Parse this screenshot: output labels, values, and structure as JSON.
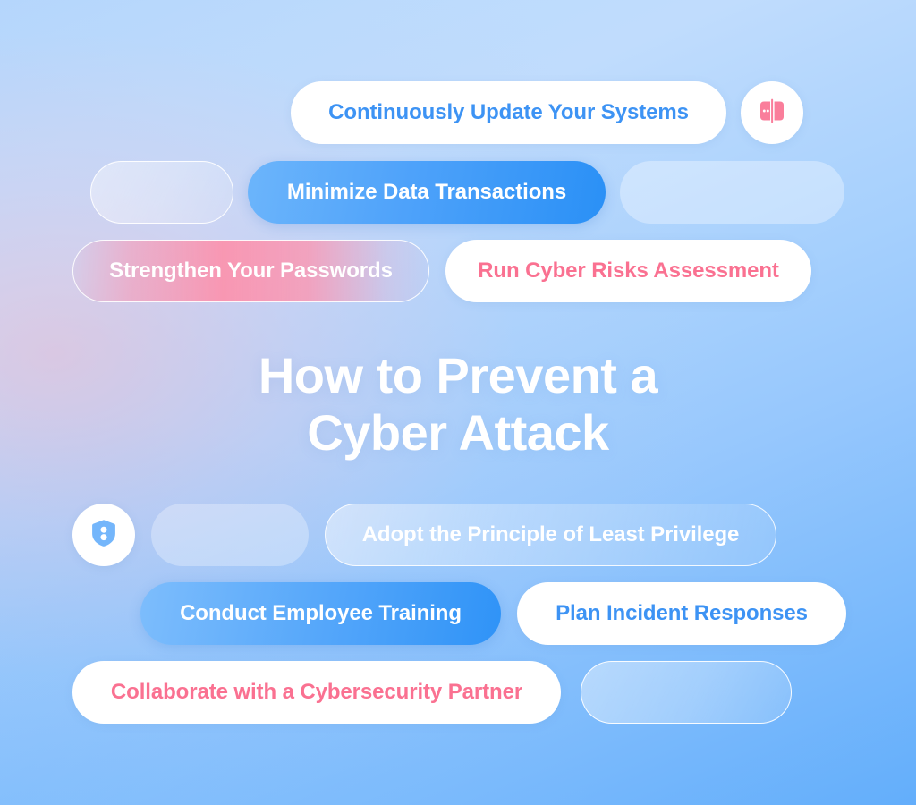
{
  "headline": {
    "line1": "How to Prevent a",
    "line2": "Cyber Attack"
  },
  "colors": {
    "text_blue": "#3d93f4",
    "text_pink": "#fa7191",
    "text_white": "#ffffff",
    "accent_pink": "#fa7191",
    "accent_blue": "#3d93f4",
    "background_top": "#b4d7fd",
    "background_bottom": "#63aefb"
  },
  "top_section": {
    "rows": [
      {
        "items": [
          {
            "kind": "pill",
            "style": "white-blue",
            "label": "Continuously Update Your Systems"
          },
          {
            "kind": "icon",
            "style": "badge-pink",
            "label": "panel-split-icon"
          }
        ]
      },
      {
        "items": [
          {
            "kind": "ghost",
            "style": "bordered",
            "label": ""
          },
          {
            "kind": "pill",
            "style": "blue",
            "label": "Minimize Data Transactions"
          },
          {
            "kind": "ghost",
            "style": "plain",
            "label": ""
          }
        ]
      },
      {
        "items": [
          {
            "kind": "pill",
            "style": "pink-ghost",
            "label": "Strengthen Your Passwords"
          },
          {
            "kind": "pill",
            "style": "white-pink",
            "label": "Run Cyber Risks Assessment"
          }
        ]
      }
    ]
  },
  "bottom_section": {
    "rows": [
      {
        "items": [
          {
            "kind": "icon",
            "style": "badge-blue",
            "label": "shield-user-icon"
          },
          {
            "kind": "ghost",
            "style": "plain-soft",
            "label": ""
          },
          {
            "kind": "pill",
            "style": "glass-border",
            "label": "Adopt the Principle of Least Privilege"
          }
        ]
      },
      {
        "items": [
          {
            "kind": "pill",
            "style": "blue-soft",
            "label": "Conduct Employee Training"
          },
          {
            "kind": "pill",
            "style": "white-blue",
            "label": "Plan Incident Responses"
          }
        ]
      },
      {
        "items": [
          {
            "kind": "pill",
            "style": "white-pink",
            "label": "Collaborate with a Cybersecurity Partner"
          },
          {
            "kind": "ghost",
            "style": "bordered",
            "label": ""
          }
        ]
      }
    ]
  }
}
